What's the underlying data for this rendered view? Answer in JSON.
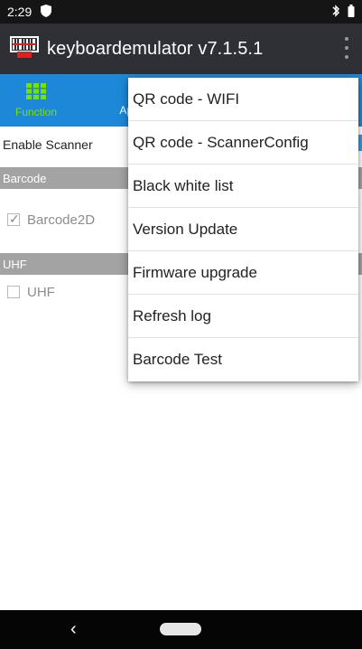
{
  "status_bar": {
    "time": "2:29"
  },
  "app_bar": {
    "title": "keyboardemulator v7.1.5.1"
  },
  "tabs": [
    {
      "label": "Function",
      "icon": "grid-icon",
      "color": "#79e000"
    },
    {
      "label": "App",
      "icon": "",
      "color": "#ffffff"
    }
  ],
  "content": {
    "enable_scanner_label": "Enable Scanner",
    "sections": [
      {
        "header": "Barcode",
        "item_label": "Barcode2D",
        "checked": true
      },
      {
        "header": "UHF",
        "item_label": "UHF",
        "checked": false
      }
    ]
  },
  "overflow_menu": {
    "items": [
      "QR code - WIFI",
      "QR code - ScannerConfig",
      "Black white list",
      "Version Update",
      "Firmware upgrade",
      "Refresh log",
      "Barcode Test"
    ]
  },
  "colors": {
    "tab_bar": "#1e88d8",
    "app_bar": "#2f3035",
    "section_header": "#a3a3a3",
    "active_tab": "#79e000"
  }
}
